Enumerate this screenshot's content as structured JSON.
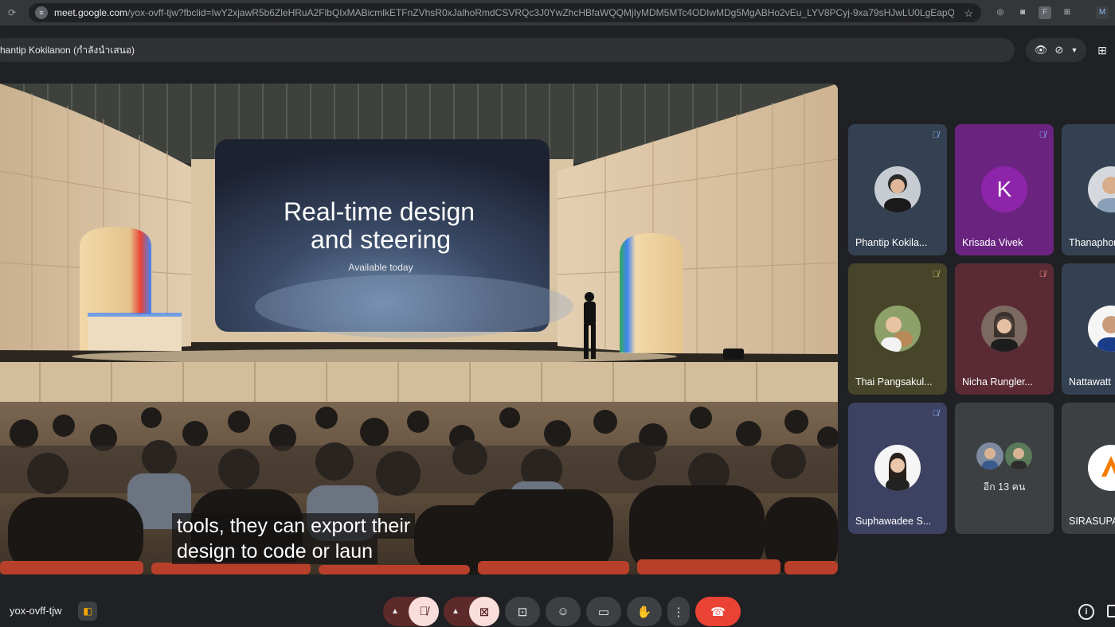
{
  "browser": {
    "url_domain": "meet.google.com",
    "url_path": "/yox-ovff-tjw?fbclid=IwY2xjawR5b6ZleHRuA2FlbQIxMABicmlkETFnZVhsR0xJalhoRmdCSVRQc3J0YwZhcHBfaWQQMjIyMDM5MTc4ODIwMDg5MgABHo2vEu_LYV8PCyj-9xa79sHJwLU0LgEapQbKp..."
  },
  "presenting": {
    "label": "hantip Kokilanon (กำลังนำเสนอ)"
  },
  "stage": {
    "screen_title_line1": "Real-time design",
    "screen_title_line2": "and steering",
    "screen_subtitle": "Available today",
    "caption_line1": "tools, they can export their",
    "caption_line2": "design to code or laun"
  },
  "participants": [
    {
      "name": "Phantip Kokila...",
      "avatar": "photo"
    },
    {
      "name": "Krisada Vivek",
      "avatar": "letter",
      "letter": "K"
    },
    {
      "name": "Thanaphon",
      "avatar": "photo"
    },
    {
      "name": "Thai Pangsakul...",
      "avatar": "photo"
    },
    {
      "name": "Nicha Rungler...",
      "avatar": "photo"
    },
    {
      "name": "Nattawatt",
      "avatar": "photo"
    },
    {
      "name": "Suphawadee S...",
      "avatar": "photo"
    },
    {
      "name": "อีก 13 คน",
      "avatar": "group"
    },
    {
      "name": "SIRASUPA",
      "avatar": "logo"
    }
  ],
  "bottom": {
    "meeting_code": "yox-ovff-tjw"
  },
  "colors": {
    "background": "#202124",
    "end_call": "#ea4335",
    "muted_button": "#f9dedc",
    "tile_purple": "#6a2480"
  },
  "icons": [
    "reload-icon",
    "star-icon",
    "eye-icon",
    "present-off-icon",
    "mic-off-icon",
    "camera-off-icon",
    "present-screen-icon",
    "emoji-icon",
    "captions-icon",
    "raise-hand-icon",
    "more-options-icon",
    "end-call-icon",
    "info-icon",
    "chat-icon"
  ]
}
